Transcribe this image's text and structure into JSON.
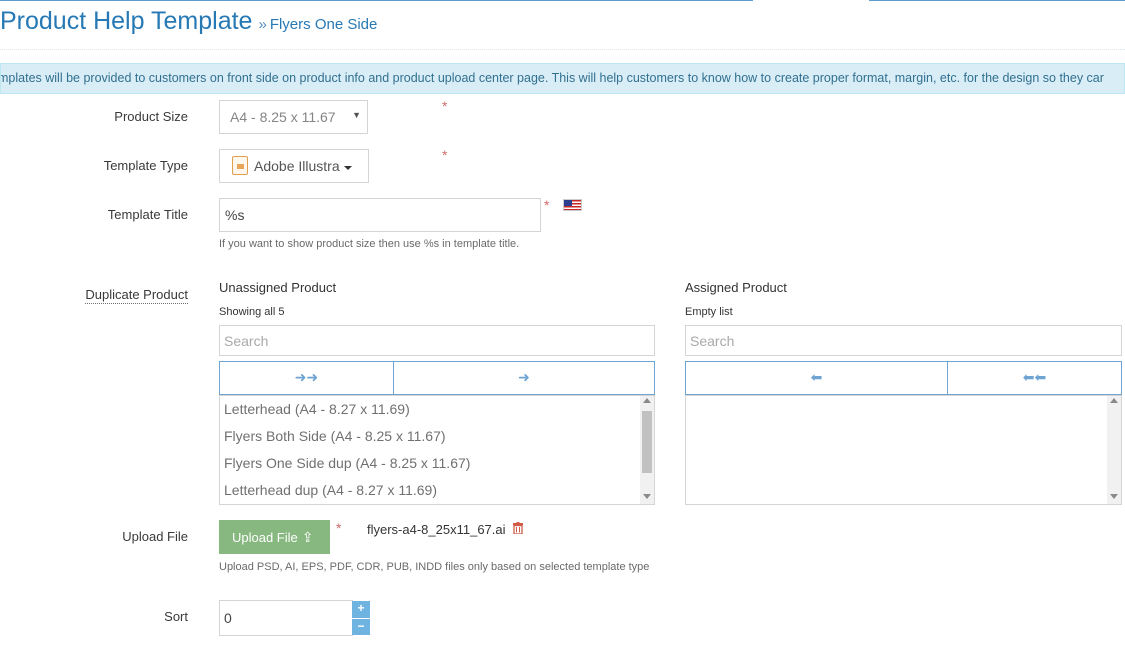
{
  "header": {
    "title": "Product Help Template",
    "separator": "»",
    "subtitle": "Flyers One Side"
  },
  "info_message": "mplates will be provided to customers on front side on product info and product upload center page. This will help customers to know how to create proper format, margin, etc. for the design so they car",
  "form": {
    "required_mark": "*",
    "product_size": {
      "label": "Product Size",
      "value": "A4 - 8.25 x 11.67",
      "caret": "▼"
    },
    "template_type": {
      "label": "Template Type",
      "value": "Adobe Illustra"
    },
    "template_title": {
      "label": "Template Title",
      "value": "%s",
      "help": "If you want to show product size then use %s in template title."
    },
    "duplicate_product": {
      "label": "Duplicate Product",
      "unassigned": {
        "title": "Unassigned Product",
        "info": "Showing all 5",
        "search_placeholder": "Search",
        "move_all_label": "➜➜",
        "move_selected_label": "➜",
        "items": [
          "Letterhead (A4 - 8.27 x 11.69)",
          "Flyers Both Side (A4 - 8.25 x 11.67)",
          "Flyers One Side dup (A4 - 8.25 x 11.67)",
          "Letterhead dup (A4 - 8.27 x 11.69)"
        ]
      },
      "assigned": {
        "title": "Assigned Product",
        "info": "Empty list",
        "search_placeholder": "Search",
        "remove_selected_label": "⬅",
        "remove_all_label": "⬅⬅",
        "items": []
      }
    },
    "upload_file": {
      "label": "Upload File",
      "button_label": "Upload File",
      "file_name": "flyers-a4-8_25x11_67.ai",
      "help": "Upload PSD, AI, EPS, PDF, CDR, PUB, INDD files only based on selected template type"
    },
    "sort": {
      "label": "Sort",
      "value": "0",
      "increment": "+",
      "decrement": "−"
    }
  },
  "colors": {
    "title": "#2679b5",
    "info_bg": "#d9edf7",
    "info_text": "#31708f",
    "required": "#d16e6c",
    "upload_button": "#87b87f",
    "spinner": "#6fb3e0",
    "move_button_border": "#6fa3d2"
  },
  "icons": {
    "template_type": "document-icon",
    "flag": "us-flag-icon",
    "upload": "upload-icon",
    "delete": "trash-icon"
  }
}
